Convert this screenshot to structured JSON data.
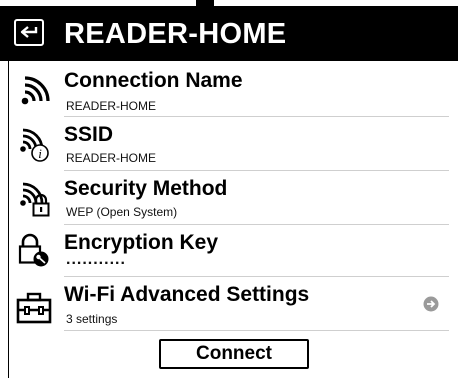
{
  "header": {
    "title": "READER-HOME",
    "back_icon": "back-arrow-icon"
  },
  "rows": [
    {
      "icon": "wifi-signal-icon",
      "title": "Connection Name",
      "subtitle": "READER-HOME"
    },
    {
      "icon": "wifi-info-icon",
      "title": "SSID",
      "subtitle": "READER-HOME"
    },
    {
      "icon": "wifi-lock-icon",
      "title": "Security Method",
      "subtitle": "WEP (Open System)"
    },
    {
      "icon": "lock-key-icon",
      "title": "Encryption Key",
      "subtitle": "..........."
    },
    {
      "icon": "toolbox-icon",
      "title": "Wi-Fi Advanced Settings",
      "subtitle": "3 settings",
      "arrow_icon": "arrow-right-circle-icon"
    }
  ],
  "connect_button": {
    "label": "Connect"
  },
  "colors": {
    "header_bg": "#000000",
    "divider": "#cfcfcf",
    "arrow": "#9a9a9a"
  }
}
